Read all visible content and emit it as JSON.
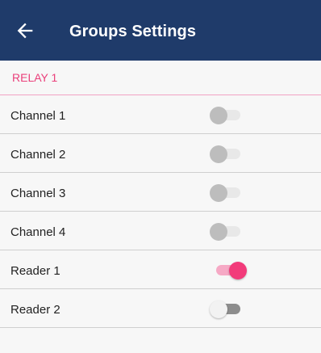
{
  "app_bar": {
    "title": "Groups Settings",
    "back_icon": "arrow-left-icon",
    "background_color": "#1f3b6a"
  },
  "section": {
    "title": "RELAY 1",
    "accent_color": "#ea3f7a"
  },
  "rows": [
    {
      "label": "Channel 1",
      "toggle": "off",
      "enabled": false
    },
    {
      "label": "Channel 2",
      "toggle": "off",
      "enabled": false
    },
    {
      "label": "Channel 3",
      "toggle": "off",
      "enabled": false
    },
    {
      "label": "Channel 4",
      "toggle": "off",
      "enabled": false
    },
    {
      "label": "Reader 1",
      "toggle": "on",
      "enabled": true
    },
    {
      "label": "Reader 2",
      "toggle": "off",
      "enabled": true
    }
  ]
}
